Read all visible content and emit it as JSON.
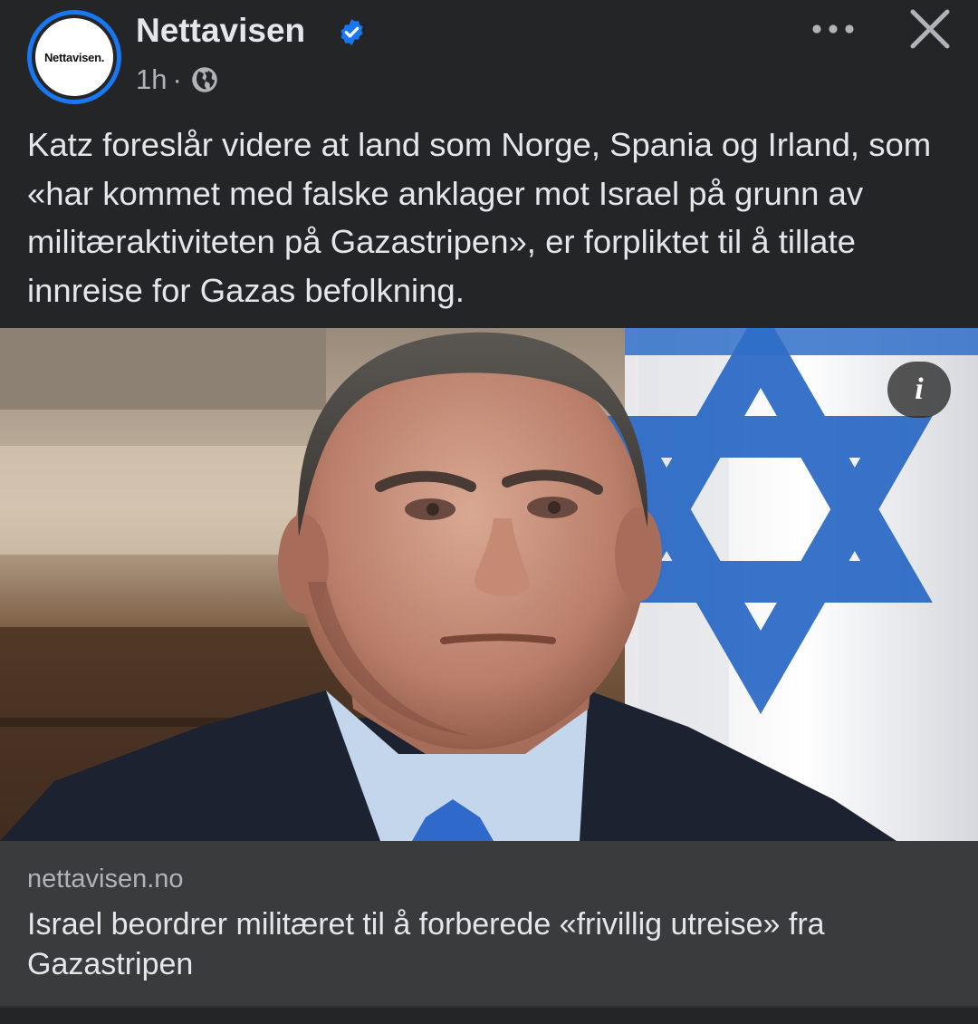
{
  "header": {
    "page_name": "Nettavisen",
    "avatar_text": "Nettavisen.",
    "timestamp": "1h",
    "separator": "·",
    "verified_color": "#1877f2"
  },
  "post": {
    "caption": "Katz foreslår videre at land som Norge, Spania og Irland, som «har kommet med falske anklager mot Israel på grunn av militæraktiviteten på Gazastripen», er forpliktet til å tillate innreise for Gazas befolkning."
  },
  "photo": {
    "info_label": "i"
  },
  "link_preview": {
    "domain": "nettavisen.no",
    "title": "Israel beordrer militæret til å forberede «frivillig utreise» fra Gazastripen"
  }
}
